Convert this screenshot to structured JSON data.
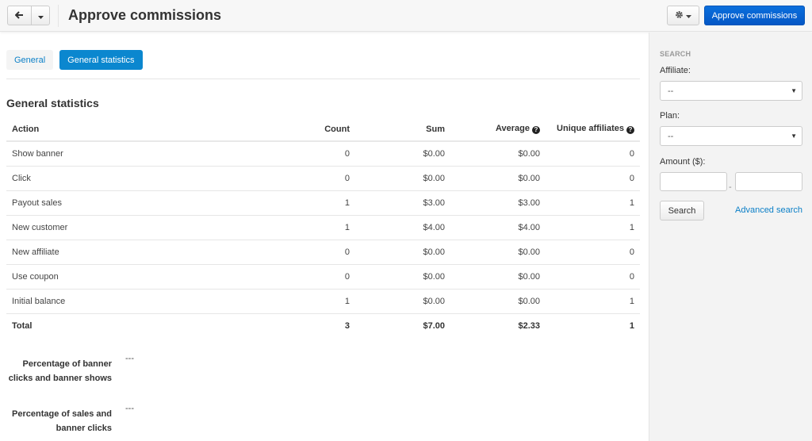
{
  "header": {
    "title": "Approve commissions",
    "back_icon": "arrow-left-icon",
    "dropdown_icon": "caret-down-icon",
    "settings_icon": "gear-icon",
    "approve_button_label": "Approve commissions"
  },
  "tabs": [
    {
      "label": "General",
      "active": false
    },
    {
      "label": "General statistics",
      "active": true
    }
  ],
  "section_title": "General statistics",
  "table": {
    "columns": [
      "Action",
      "Count",
      "Sum",
      "Average",
      "Unique affiliates"
    ],
    "rows": [
      [
        "Show banner",
        "0",
        "$0.00",
        "$0.00",
        "0"
      ],
      [
        "Click",
        "0",
        "$0.00",
        "$0.00",
        "0"
      ],
      [
        "Payout sales",
        "1",
        "$3.00",
        "$3.00",
        "1"
      ],
      [
        "New customer",
        "1",
        "$4.00",
        "$4.00",
        "1"
      ],
      [
        "New affiliate",
        "0",
        "$0.00",
        "$0.00",
        "0"
      ],
      [
        "Use coupon",
        "0",
        "$0.00",
        "$0.00",
        "0"
      ],
      [
        "Initial balance",
        "1",
        "$0.00",
        "$0.00",
        "1"
      ]
    ],
    "total": [
      "Total",
      "3",
      "$7.00",
      "$2.33",
      "1"
    ]
  },
  "percentages": [
    {
      "label": "Percentage of banner clicks and banner shows",
      "value": "---"
    },
    {
      "label": "Percentage of sales and banner clicks",
      "value": "---"
    }
  ],
  "sidebar": {
    "heading": "SEARCH",
    "affiliate_label": "Affiliate:",
    "affiliate_value": "--",
    "plan_label": "Plan:",
    "plan_value": "--",
    "amount_label": "Amount ($):",
    "amount_from": "",
    "amount_to": "",
    "amount_separator": "-",
    "search_button": "Search",
    "advanced_link": "Advanced search"
  },
  "colors": {
    "primary_button": "#0558c6",
    "active_tab": "#0b87cf",
    "link": "#0b7fc7"
  }
}
